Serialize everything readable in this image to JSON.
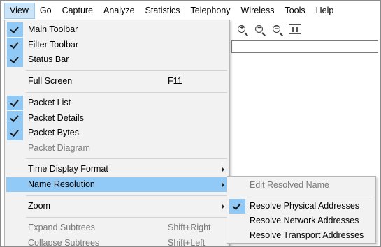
{
  "menubar": {
    "items": [
      {
        "label": "View",
        "active": true
      },
      {
        "label": "Go"
      },
      {
        "label": "Capture"
      },
      {
        "label": "Analyze"
      },
      {
        "label": "Statistics"
      },
      {
        "label": "Telephony"
      },
      {
        "label": "Wireless"
      },
      {
        "label": "Tools"
      },
      {
        "label": "Help"
      }
    ]
  },
  "view_menu": {
    "main_toolbar": {
      "label": "Main Toolbar",
      "checked": true
    },
    "filter_toolbar": {
      "label": "Filter Toolbar",
      "checked": true
    },
    "status_bar": {
      "label": "Status Bar",
      "checked": true
    },
    "full_screen": {
      "label": "Full Screen",
      "shortcut": "F11"
    },
    "packet_list": {
      "label": "Packet List",
      "checked": true
    },
    "packet_details": {
      "label": "Packet Details",
      "checked": true
    },
    "packet_bytes": {
      "label": "Packet Bytes",
      "checked": true
    },
    "packet_diagram": {
      "label": "Packet Diagram",
      "disabled": true
    },
    "time_display_format": {
      "label": "Time Display Format"
    },
    "name_resolution": {
      "label": "Name Resolution",
      "highlighted": true
    },
    "zoom": {
      "label": "Zoom"
    },
    "expand_subtrees": {
      "label": "Expand Subtrees",
      "shortcut": "Shift+Right",
      "disabled": true
    },
    "collapse_subtrees": {
      "label": "Collapse Subtrees",
      "shortcut": "Shift+Left",
      "disabled": true
    }
  },
  "name_resolution_submenu": {
    "edit_resolved_name": {
      "label": "Edit Resolved Name",
      "disabled": true
    },
    "resolve_physical": {
      "label": "Resolve Physical Addresses",
      "checked": true
    },
    "resolve_network": {
      "label": "Resolve Network Addresses",
      "checked": false
    },
    "resolve_transport": {
      "label": "Resolve Transport Addresses",
      "checked": false
    }
  },
  "toolbar_icons": [
    "zoom-in-icon",
    "zoom-out-icon",
    "normal-size-icon",
    "resize-columns-icon"
  ],
  "colors": {
    "menu_bg": "#f2f2f2",
    "highlight": "#91c9f7",
    "check_bg": "#90c8f6",
    "active_menu_bg": "#cce4f7",
    "disabled_text": "#7a7a7a"
  }
}
